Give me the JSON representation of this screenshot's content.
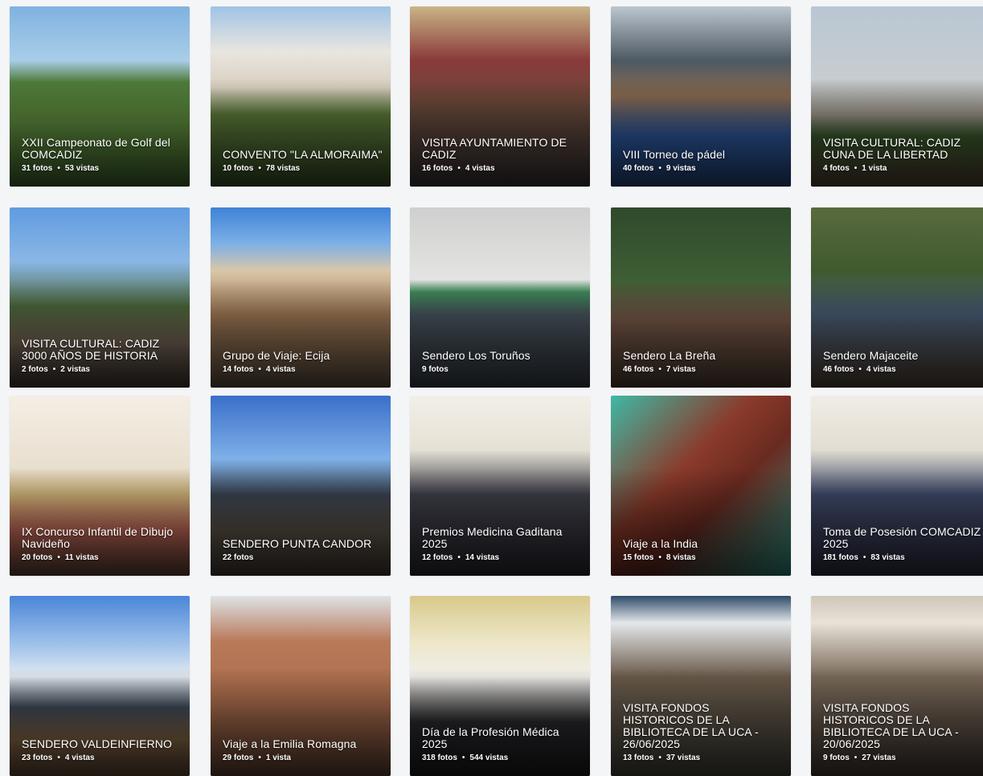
{
  "albums": [
    {
      "title": "XXII Campeonato de Golf del COMCADIZ",
      "photos": "31 fotos",
      "views": "53 vistas",
      "bg": "linear-gradient(to bottom,#7fb2e0 0%,#a9cde8 30%,#4e7b3a 42%,#5f8d3e 65%,#4a7232 100%)"
    },
    {
      "title": "CONVENTO \"LA ALMORAIMA\"",
      "photos": "10 fotos",
      "views": "78 vistas",
      "bg": "linear-gradient(to bottom,#9fc3e6 0%,#e9e6df 25%,#d8cfbf 45%,#5d7a3a 60%,#3f5a2b 100%)"
    },
    {
      "title": "VISITA AYUNTAMIENTO DE CADIZ",
      "photos": "16 fotos",
      "views": "4 vistas",
      "bg": "linear-gradient(to bottom,#c9b487 0%,#8a3a3a 30%,#6b4a3a 55%,#3d3a3a 100%)"
    },
    {
      "title": "VIII Torneo de pádel",
      "photos": "40 fotos",
      "views": "9 vistas",
      "bg": "linear-gradient(to bottom,#bcc6cf 0%,#4d5963 30%,#8a6a4f 50%,#2e5aa0 72%,#284c8a 100%)"
    },
    {
      "title": "VISITA CULTURAL: CADIZ CUNA DE LA LIBERTAD",
      "photos": "4 fotos",
      "views": "1 vista",
      "bg": "linear-gradient(to bottom,#b9c6d3 0%,#c7cdd1 40%,#9c9588 60%,#3a5a2c 72%,#5a4a3a 100%)"
    },
    {
      "title": "VISITA CULTURAL: CADIZ 3000 AÑOS DE HISTORIA",
      "photos": "2 fotos",
      "views": "2 vistas",
      "bg": "linear-gradient(to bottom,#5f9be0 0%,#8ab7e6 30%,#4d6a3c 55%,#7a6a5a 75%,#4a3f38 100%)"
    },
    {
      "title": "Grupo de Viaje: Ecija",
      "photos": "14 fotos",
      "views": "4 vistas",
      "bg": "linear-gradient(to bottom,#3f82d8 0%,#7db0e6 20%,#d9c6a8 35%,#a37a55 60%,#6b5a48 100%)"
    },
    {
      "title": "Sendero Los Toruños",
      "photos": "9 fotos",
      "views": "",
      "bg": "linear-gradient(to bottom,#cfcfcf 0%,#e4e4e2 40%,#3f8a5a 47%,#4a5560 60%,#3e4650 100%)"
    },
    {
      "title": "Sendero La Breña",
      "photos": "46 fotos",
      "views": "7 vistas",
      "bg": "linear-gradient(to bottom,#2f4a2c 0%,#3e5e35 40%,#7a5a4a 62%,#5a4638 100%)"
    },
    {
      "title": "Sendero Majaceite",
      "photos": "46 fotos",
      "views": "4 vistas",
      "bg": "linear-gradient(to bottom,#5a6a3f 0%,#3f5a2d 35%,#4a5f7a 60%,#5a4a3a 100%)"
    },
    {
      "title": "IX Concurso Infantil de Dibujo Navideño",
      "photos": "20 fotos",
      "views": "11 vistas",
      "bg": "linear-gradient(to bottom,#f4eee4 0%,#e9dfcf 40%,#d4b77a 55%,#c86a5a 75%,#6a4a3a 100%)"
    },
    {
      "title": "SENDERO PUNTA CANDOR",
      "photos": "22 fotos",
      "views": "",
      "bg": "linear-gradient(to bottom,#3a6fc9 0%,#7fb0e8 35%,#3b4452 55%,#5a5247 75%,#4a4138 100%)"
    },
    {
      "title": "Premios Medicina Gaditana 2025",
      "photos": "12 fotos",
      "views": "14 vistas",
      "bg": "linear-gradient(to bottom,#f2efe8 0%,#e6e1d5 30%,#3f3f4a 55%,#2f2f37 100%)"
    },
    {
      "title": "Viaje a la India",
      "photos": "15 fotos",
      "views": "8 vistas",
      "bg": "linear-gradient(135deg,#3fb9a5 0%,#8a3a2a 40%,#6a2a20 60%,#2e9a8a 100%)"
    },
    {
      "title": "Toma de Posesión COMCADIZ 2025",
      "photos": "181 fotos",
      "views": "83 vistas",
      "bg": "linear-gradient(to bottom,#f0ede6 0%,#e2ddd2 30%,#3f4a6a 55%,#34324a 100%)"
    },
    {
      "title": "SENDERO VALDEINFIERNO",
      "photos": "23 fotos",
      "views": "4 vistas",
      "bg": "linear-gradient(to bottom,#4a86d8 0%,#a9c8ec 30%,#e4eaf0 45%,#3f4a5a 62%,#8a6a48 80%,#6a5038 100%)"
    },
    {
      "title": "Viaje a la Emilia Romagna",
      "photos": "29 fotos",
      "views": "1 vista",
      "bg": "linear-gradient(to bottom,#dfe3e6 0%,#b97a5a 25%,#a86a4a 60%,#6a4a38 100%)"
    },
    {
      "title": "Día de la Profesión Médica 2025",
      "photos": "318 fotos",
      "views": "544 vistas",
      "bg": "linear-gradient(to bottom,#d8c98a 0%,#ede6c7 25%,#f1efea 45%,#2a2a2e 70%,#1e1e22 100%)"
    },
    {
      "title": "VISITA FONDOS HISTORICOS DE LA BIBLIOTECA DE LA UCA - 26/06/2025",
      "photos": "13 fotos",
      "views": "37 vistas",
      "bg": "linear-gradient(to bottom,#2e4a6a 0%,#e4e8ea 15%,#6a5a4a 45%,#4a4a40 100%)"
    },
    {
      "title": "VISITA FONDOS HISTORICOS DE LA BIBLIOTECA DE LA UCA - 20/06/2025",
      "photos": "9 fotos",
      "views": "27 vistas",
      "bg": "linear-gradient(to bottom,#cfc7b8 0%,#e8e2d8 15%,#7a6a5a 45%,#4a4038 100%)"
    }
  ]
}
